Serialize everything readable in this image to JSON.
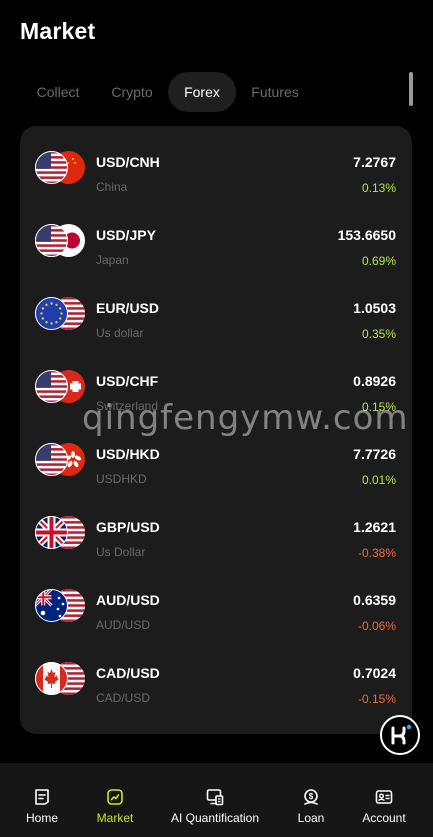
{
  "header": {
    "title": "Market"
  },
  "tabs": [
    {
      "label": "Collect"
    },
    {
      "label": "Crypto"
    },
    {
      "label": "Forex"
    },
    {
      "label": "Futures"
    }
  ],
  "active_tab": "Forex",
  "markets": [
    {
      "pair": "USD/CNH",
      "region": "China",
      "price": "7.2767",
      "change": "0.13%",
      "trend": "up"
    },
    {
      "pair": "USD/JPY",
      "region": "Japan",
      "price": "153.6650",
      "change": "0.69%",
      "trend": "up"
    },
    {
      "pair": "EUR/USD",
      "region": "Us dollar",
      "price": "1.0503",
      "change": "0.35%",
      "trend": "up"
    },
    {
      "pair": "USD/CHF",
      "region": "Switzerland",
      "price": "0.8926",
      "change": "0.15%",
      "trend": "up"
    },
    {
      "pair": "USD/HKD",
      "region": "USDHKD",
      "price": "7.7726",
      "change": "0.01%",
      "trend": "up"
    },
    {
      "pair": "GBP/USD",
      "region": "Us Dollar",
      "price": "1.2621",
      "change": "-0.38%",
      "trend": "down"
    },
    {
      "pair": "AUD/USD",
      "region": "AUD/USD",
      "price": "0.6359",
      "change": "-0.06%",
      "trend": "down"
    },
    {
      "pair": "CAD/USD",
      "region": "CAD/USD",
      "price": "0.7024",
      "change": "-0.15%",
      "trend": "down"
    }
  ],
  "watermark": "qingfengymw.com",
  "bottom_nav": [
    {
      "label": "Home",
      "icon": "home-icon"
    },
    {
      "label": "Market",
      "icon": "market-icon"
    },
    {
      "label": "AI Quantification",
      "icon": "ai-quantification-icon"
    },
    {
      "label": "Loan",
      "icon": "loan-icon"
    },
    {
      "label": "Account",
      "icon": "account-icon"
    }
  ],
  "colors": {
    "up": "#b7e34a",
    "down": "#ea6a3a",
    "accent": "#c9e52e",
    "card": "#1c1c1c"
  }
}
